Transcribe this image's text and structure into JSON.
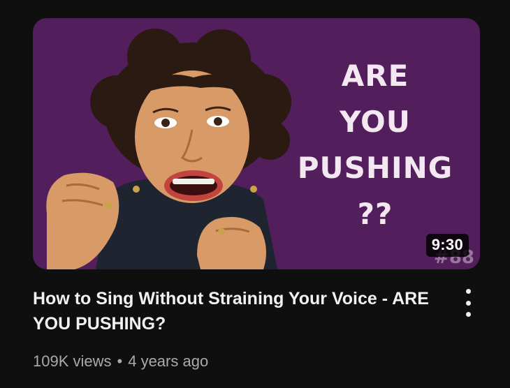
{
  "video": {
    "thumbnail": {
      "headline_lines": [
        "ARE",
        "YOU",
        "PUSHING",
        "??"
      ],
      "episode_tag": "#88",
      "background_color": "#531e5c",
      "duration": "9:30"
    },
    "title": "How to Sing Without Straining Your Voice - ARE YOU PUSHING?",
    "views": "109K views",
    "separator": "•",
    "age": "4 years ago",
    "menu_icon": "more-vertical-icon"
  }
}
